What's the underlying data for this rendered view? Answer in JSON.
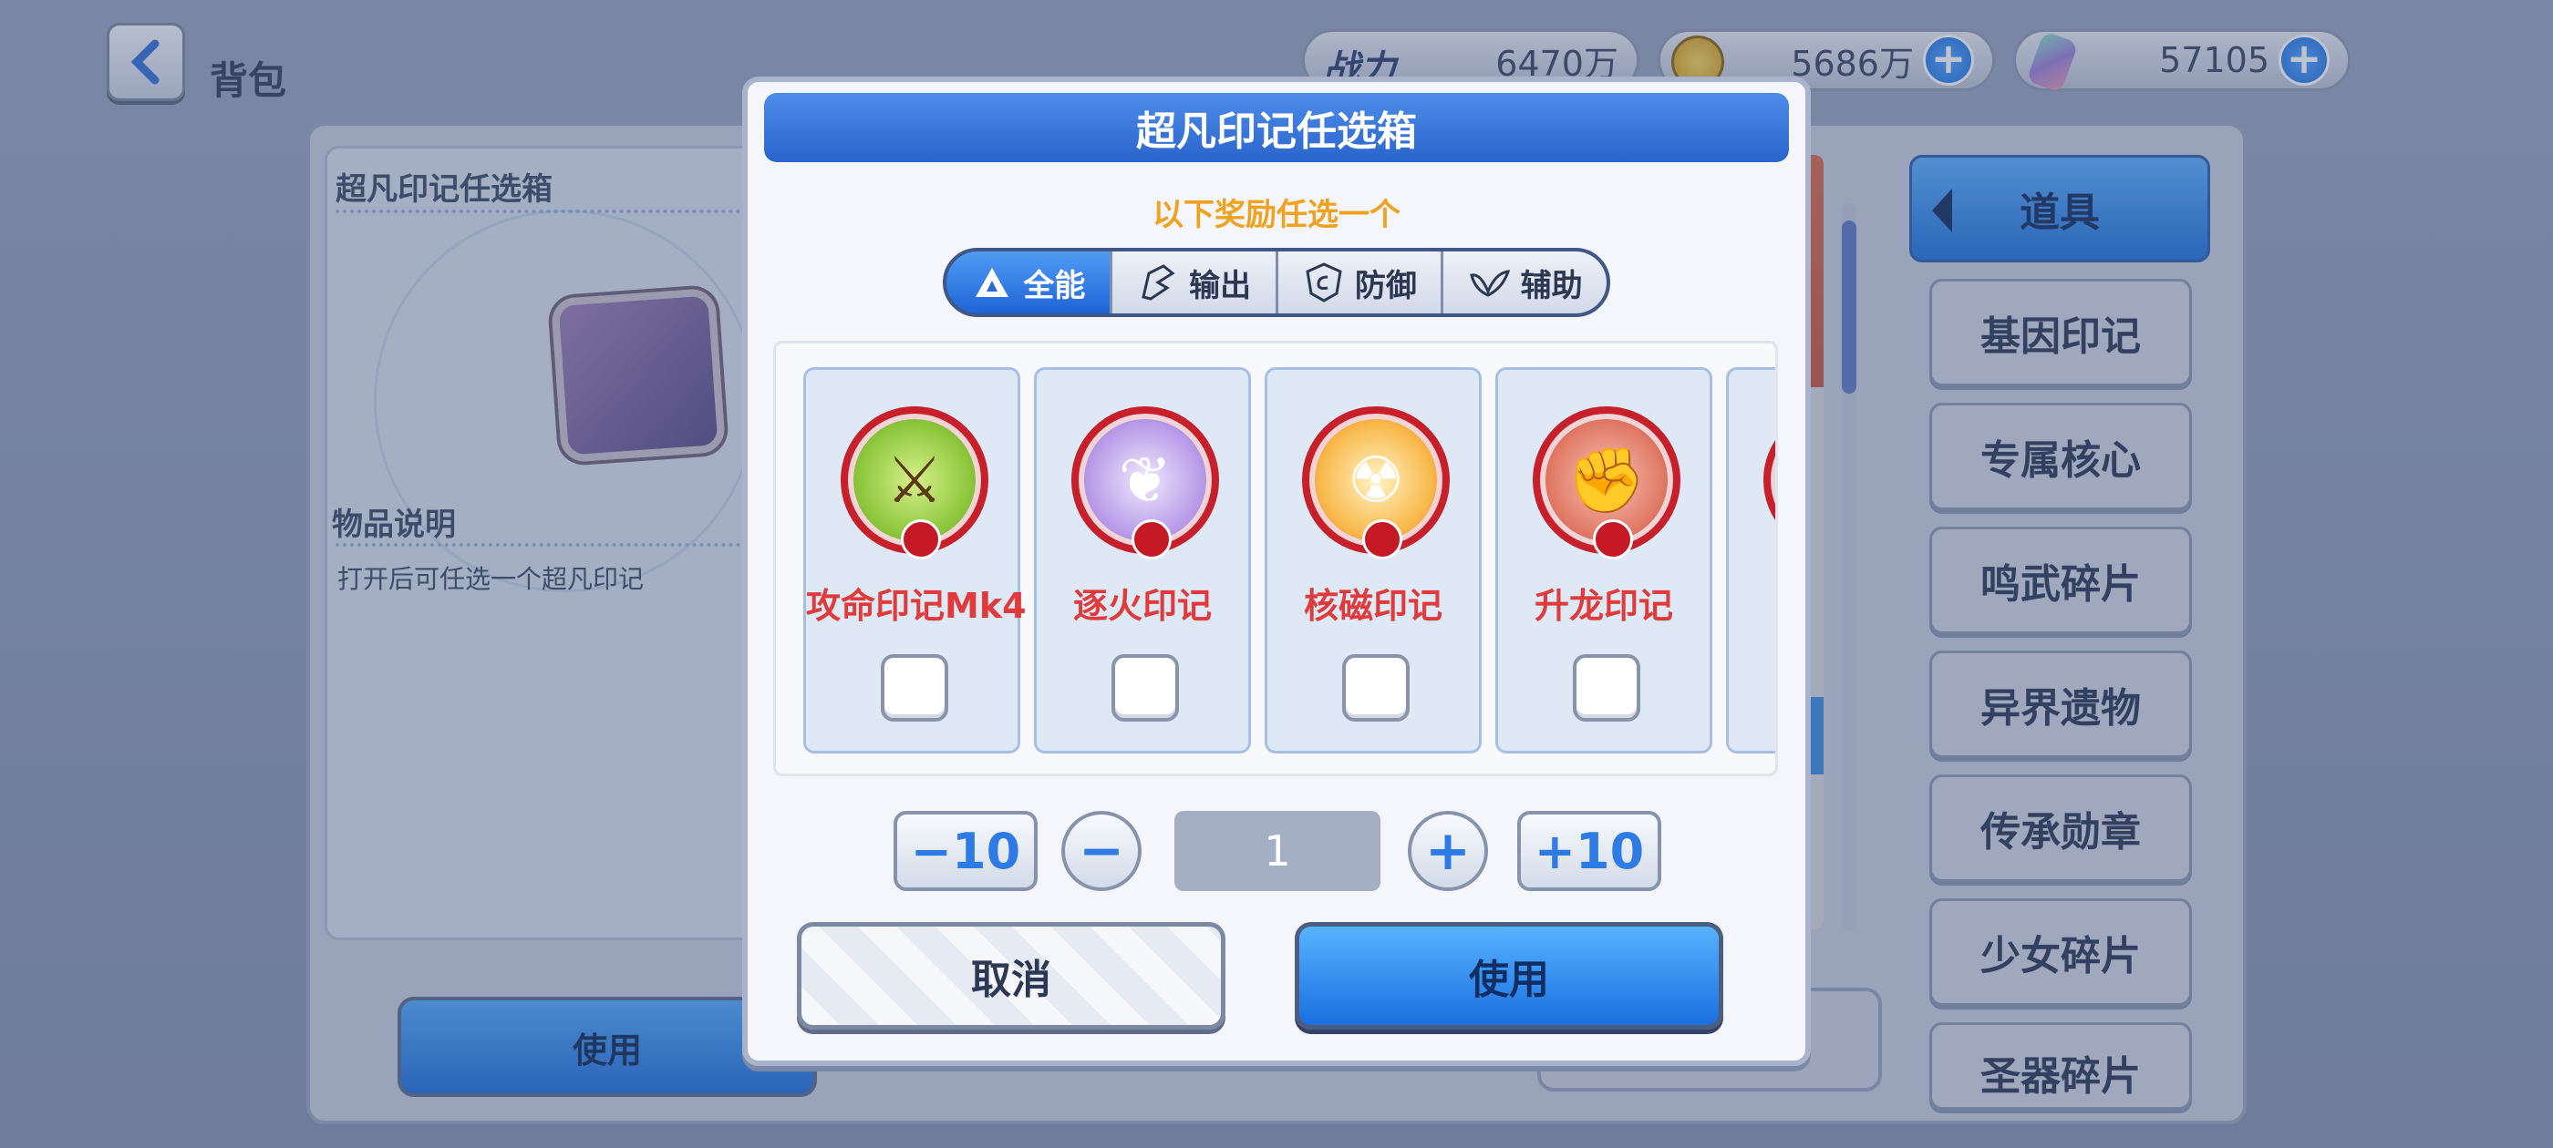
{
  "header": {
    "title": "背包",
    "stats": [
      {
        "label": "战力",
        "value": "6470万"
      },
      {
        "value": "5686万"
      },
      {
        "value": "57105"
      }
    ]
  },
  "left_panel": {
    "item_title": "超凡印记任选箱",
    "desc_title": "物品说明",
    "desc": "打开后可任选一个超凡印记",
    "use_label": "使用"
  },
  "categories": {
    "active": "道具",
    "items": [
      "基因印记",
      "专属核心",
      "鸣武碎片",
      "异界遗物",
      "传承勋章",
      "少女碎片",
      "圣器碎片"
    ]
  },
  "dialog": {
    "title": "超凡印记任选箱",
    "subtitle": "以下奖励任选一个",
    "tabs": [
      "全能",
      "输出",
      "防御",
      "辅助"
    ],
    "active_tab": "全能",
    "rewards": [
      {
        "name": "攻命印记Mk4",
        "icon": "sword-icon",
        "checked": false
      },
      {
        "name": "逐火印记",
        "icon": "butterfly-icon",
        "checked": false
      },
      {
        "name": "核磁印记",
        "icon": "radiation-icon",
        "checked": false
      },
      {
        "name": "升龙印记",
        "icon": "fist-icon",
        "checked": false
      }
    ],
    "stepper": {
      "minus10": "−10",
      "minus": "−",
      "value": "1",
      "plus": "+",
      "plus10": "+10"
    },
    "cancel_label": "取消",
    "use_label": "使用"
  },
  "colors": {
    "accent": "#2a64cc",
    "subtitle": "#f0a21e",
    "reward_name": "#e03a3a"
  }
}
